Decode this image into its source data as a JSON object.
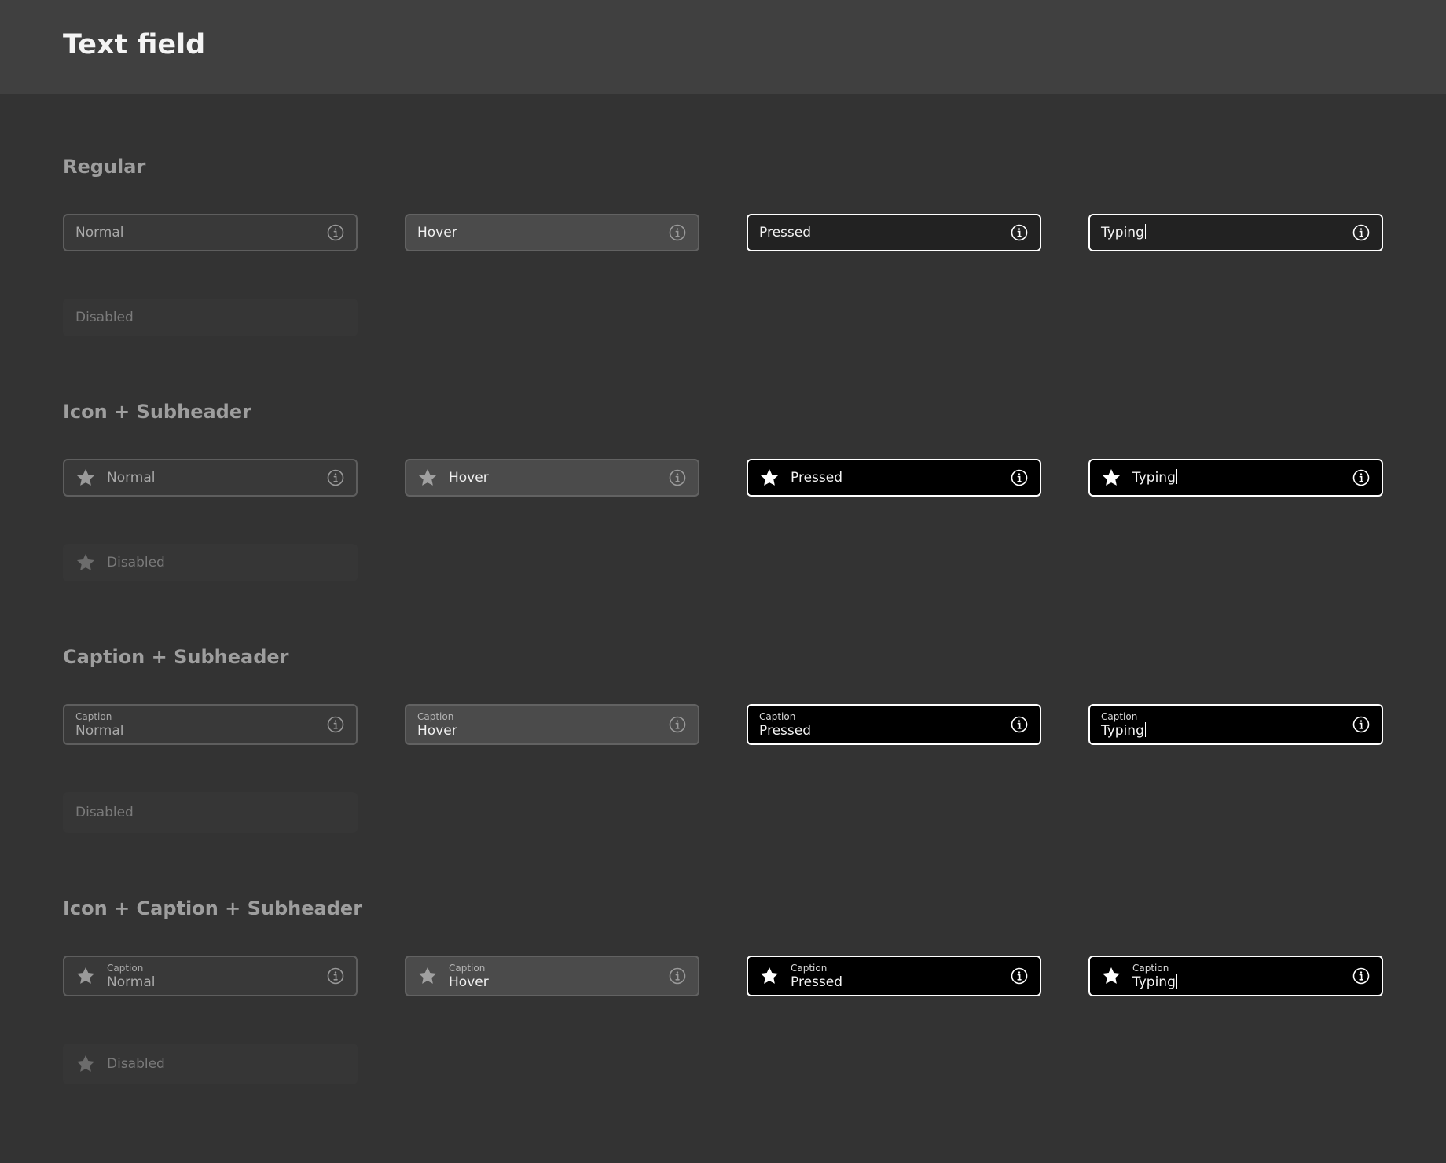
{
  "page": {
    "title": "Text field"
  },
  "colors": {
    "background": "#333333",
    "header": "#404040",
    "pressed_border": "#ffffff",
    "pressed_background": "#000000"
  },
  "icons": {
    "leading": "star-icon",
    "trailing": "info-icon"
  },
  "sections": [
    {
      "title": "Regular",
      "fields": {
        "normal": {
          "value": "Normal"
        },
        "hover": {
          "value": "Hover"
        },
        "pressed": {
          "value": "Pressed"
        },
        "typing": {
          "value": "Typing"
        },
        "disabled": {
          "value": "Disabled"
        }
      }
    },
    {
      "title": "Icon + Subheader",
      "fields": {
        "normal": {
          "value": "Normal"
        },
        "hover": {
          "value": "Hover"
        },
        "pressed": {
          "value": "Pressed"
        },
        "typing": {
          "value": "Typing"
        },
        "disabled": {
          "value": "Disabled"
        }
      }
    },
    {
      "title": "Caption + Subheader",
      "fields": {
        "normal": {
          "caption": "Caption",
          "value": "Normal"
        },
        "hover": {
          "caption": "Caption",
          "value": "Hover"
        },
        "pressed": {
          "caption": "Caption",
          "value": "Pressed"
        },
        "typing": {
          "caption": "Caption",
          "value": "Typing"
        },
        "disabled": {
          "value": "Disabled"
        }
      }
    },
    {
      "title": "Icon + Caption + Subheader",
      "fields": {
        "normal": {
          "caption": "Caption",
          "value": "Normal"
        },
        "hover": {
          "caption": "Caption",
          "value": "Hover"
        },
        "pressed": {
          "caption": "Caption",
          "value": "Pressed"
        },
        "typing": {
          "caption": "Caption",
          "value": "Typing"
        },
        "disabled": {
          "value": "Disabled"
        }
      }
    }
  ]
}
